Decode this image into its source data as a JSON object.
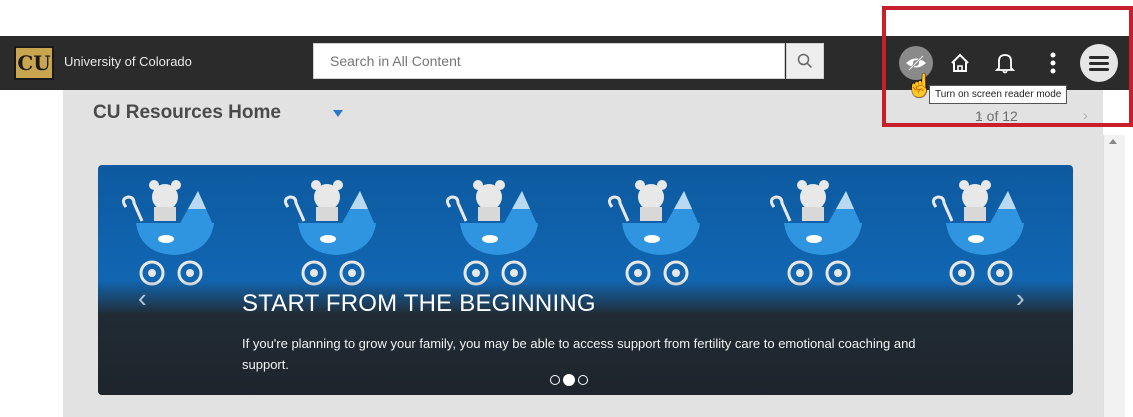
{
  "header": {
    "logo_text": "CU",
    "org_name": "University of Colorado",
    "search_placeholder": "Search in All Content",
    "tooltip": "Turn on screen reader mode",
    "icons": [
      "search-icon",
      "eye-slash-icon",
      "home-icon",
      "bell-icon",
      "more-vertical-icon",
      "hamburger-menu-icon"
    ]
  },
  "page": {
    "title": "CU Resources Home",
    "pager": "1 of 12"
  },
  "banner": {
    "title": "START FROM THE BEGINNING",
    "text": "If you're planning to grow your family, you may be able to access support from fertility care to emotional coaching and support.",
    "slide_count": 3,
    "active_slide": 2
  },
  "colors": {
    "topbar": "#2b2b2b",
    "banner_blue": "#1572c4",
    "highlight_red": "#c8202a",
    "accent_blue": "#2a78c8"
  }
}
